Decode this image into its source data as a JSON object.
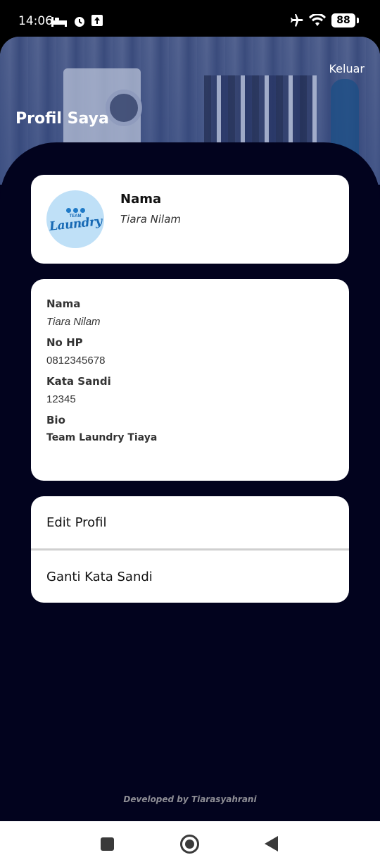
{
  "status_bar": {
    "time": "14:06",
    "battery": "88"
  },
  "header": {
    "logout_label": "Keluar",
    "title": "Profil Saya"
  },
  "profile_card": {
    "name_label": "Nama",
    "name_value": "Tiara Nilam",
    "avatar_text_top": "TEAM",
    "avatar_text_main": "Laundry"
  },
  "details": {
    "name_label": "Nama",
    "name_value": "Tiara Nilam",
    "phone_label": "No HP",
    "phone_value": "0812345678",
    "password_label": "Kata Sandi",
    "password_value": "12345",
    "bio_label": "Bio",
    "bio_value": "Team Laundry Tiaya"
  },
  "menu": {
    "edit_profile": "Edit Profil",
    "change_password": "Ganti Kata Sandi"
  },
  "footer": {
    "credit": "Developed by Tiarasyahrani"
  },
  "colors": {
    "background": "#02031e",
    "card": "#ffffff",
    "avatar_bg": "#bfe0f7",
    "brand_blue": "#1769b4"
  }
}
